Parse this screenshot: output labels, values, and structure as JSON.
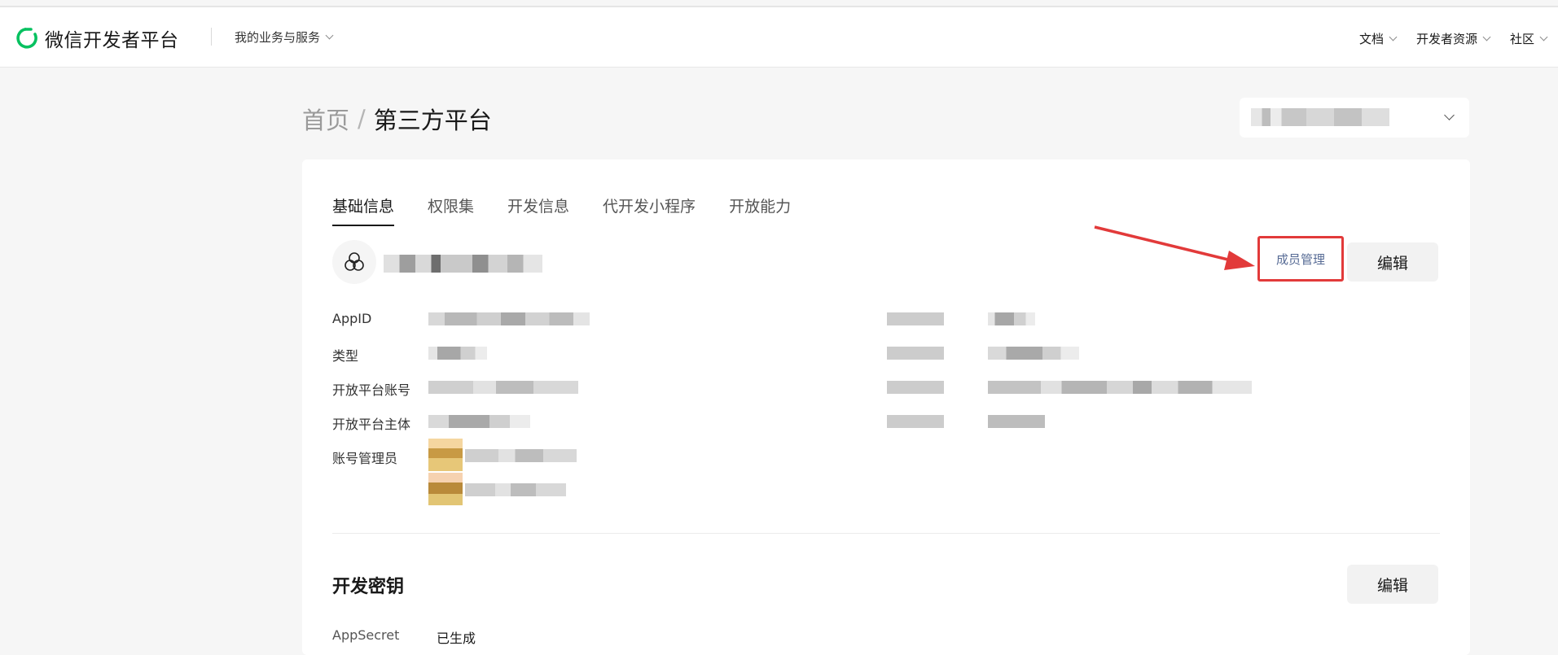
{
  "header": {
    "brand": "微信开发者平台",
    "business_menu": "我的业务与服务",
    "nav": [
      {
        "label": "文档"
      },
      {
        "label": "开发者资源"
      },
      {
        "label": "社区"
      }
    ]
  },
  "breadcrumb": {
    "home": "首页",
    "separator": "/",
    "current": "第三方平台"
  },
  "tabs": [
    {
      "label": "基础信息",
      "active": true
    },
    {
      "label": "权限集",
      "active": false
    },
    {
      "label": "开发信息",
      "active": false
    },
    {
      "label": "代开发小程序",
      "active": false
    },
    {
      "label": "开放能力",
      "active": false
    }
  ],
  "actions": {
    "member_manage": "成员管理",
    "edit": "编辑"
  },
  "info_labels": {
    "appid": "AppID",
    "type": "类型",
    "account": "开放平台账号",
    "subject": "开放平台主体",
    "admins": "账号管理员"
  },
  "dev_key": {
    "title": "开发密钥",
    "edit": "编辑",
    "secret_label": "AppSecret",
    "secret_value": "已生成"
  },
  "colors": {
    "brand_green": "#07c160",
    "link_blue": "#576b95",
    "highlight_red": "#e23a3a"
  }
}
